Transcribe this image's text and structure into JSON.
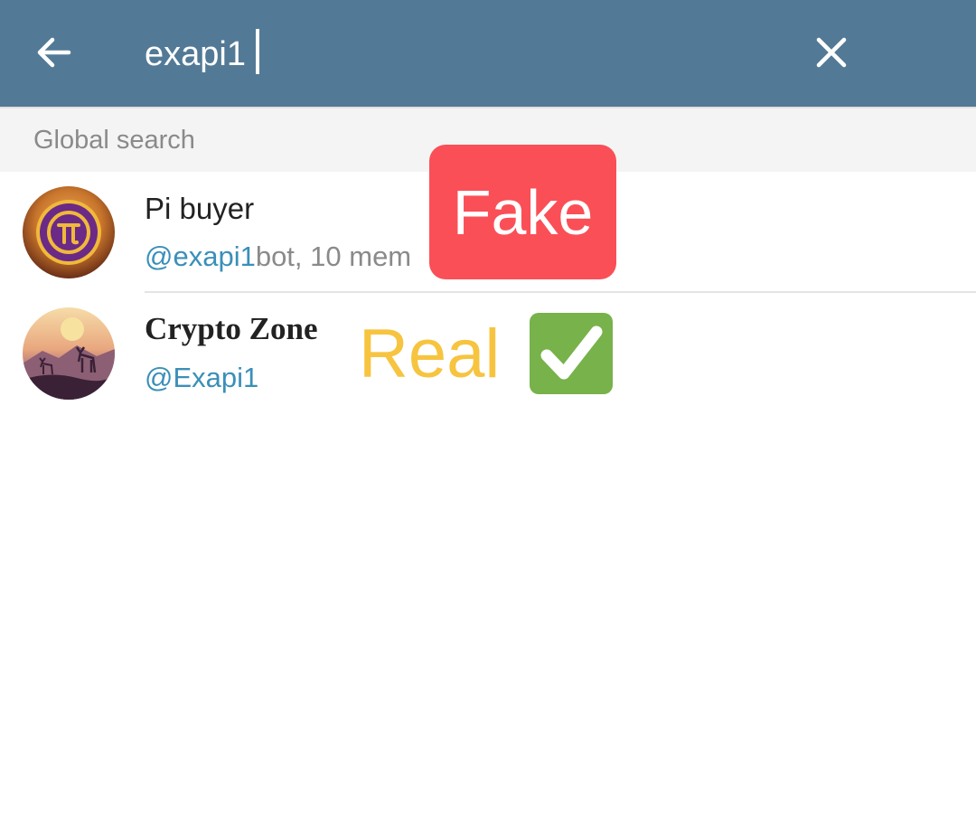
{
  "search": {
    "query": "exapi1",
    "back_icon": "arrow-left-icon",
    "clear_icon": "close-icon"
  },
  "section": {
    "title": "Global search"
  },
  "results": [
    {
      "name": "Pi buyer",
      "handle": "@exapi1",
      "meta": "bot, 10 mem",
      "avatar": "pi-coin-avatar"
    },
    {
      "name": "Crypto Zone",
      "handle": "@Exapi1",
      "avatar": "deer-sunset-avatar"
    }
  ],
  "overlays": {
    "fake": "Fake",
    "real": "Real",
    "check_icon": "check-mark-button-icon"
  },
  "colors": {
    "topbar": "#527a96",
    "handle": "#3b8fb9",
    "fake_bg": "#fa4f57",
    "real_text": "#f7c440",
    "check_bg": "#78b24a"
  }
}
